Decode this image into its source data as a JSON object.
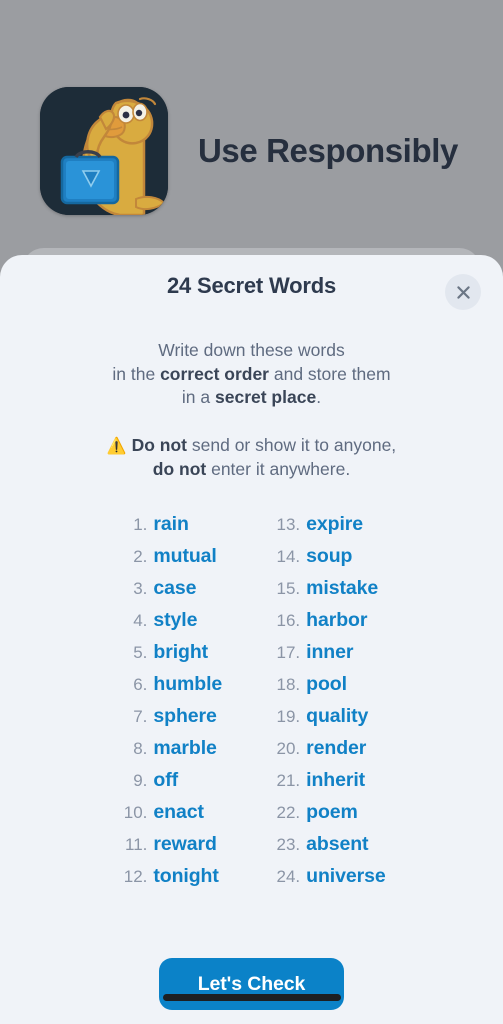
{
  "header": {
    "title": "Use Responsibly",
    "avatar_icon": "duck-shush-avatar"
  },
  "sheet": {
    "title": "24 Secret Words",
    "close_icon": "close-icon",
    "instructions": {
      "line1": "Write down these words",
      "line2_pre": "in the ",
      "line2_bold": "correct order",
      "line2_post": " and store them",
      "line3_pre": "in a ",
      "line3_bold": "secret place",
      "line3_post": "."
    },
    "warning": {
      "icon": "⚠️",
      "icon_name": "warning-triangle-icon",
      "line1_bold": "Do not",
      "line1_rest": " send or show it to anyone,",
      "line2_bold": "do not",
      "line2_rest": " enter it anywhere."
    },
    "words": [
      {
        "num": "1.",
        "word": "rain"
      },
      {
        "num": "2.",
        "word": "mutual"
      },
      {
        "num": "3.",
        "word": "case"
      },
      {
        "num": "4.",
        "word": "style"
      },
      {
        "num": "5.",
        "word": "bright"
      },
      {
        "num": "6.",
        "word": "humble"
      },
      {
        "num": "7.",
        "word": "sphere"
      },
      {
        "num": "8.",
        "word": "marble"
      },
      {
        "num": "9.",
        "word": "off"
      },
      {
        "num": "10.",
        "word": "enact"
      },
      {
        "num": "11.",
        "word": "reward"
      },
      {
        "num": "12.",
        "word": "tonight"
      },
      {
        "num": "13.",
        "word": "expire"
      },
      {
        "num": "14.",
        "word": "soup"
      },
      {
        "num": "15.",
        "word": "mistake"
      },
      {
        "num": "16.",
        "word": "harbor"
      },
      {
        "num": "17.",
        "word": "inner"
      },
      {
        "num": "18.",
        "word": "pool"
      },
      {
        "num": "19.",
        "word": "quality"
      },
      {
        "num": "20.",
        "word": "render"
      },
      {
        "num": "21.",
        "word": "inherit"
      },
      {
        "num": "22.",
        "word": "poem"
      },
      {
        "num": "23.",
        "word": "absent"
      },
      {
        "num": "24.",
        "word": "universe"
      }
    ],
    "cta_label": "Let's Check"
  },
  "colors": {
    "accent": "#0b82c8",
    "word": "#1181c6",
    "number": "#8b95a6",
    "title": "#2e3a4e",
    "body": "#5f6b80",
    "sheet_bg": "#f0f3f8",
    "backdrop": "#9b9da1",
    "warning_yellow": "#f5c518"
  }
}
